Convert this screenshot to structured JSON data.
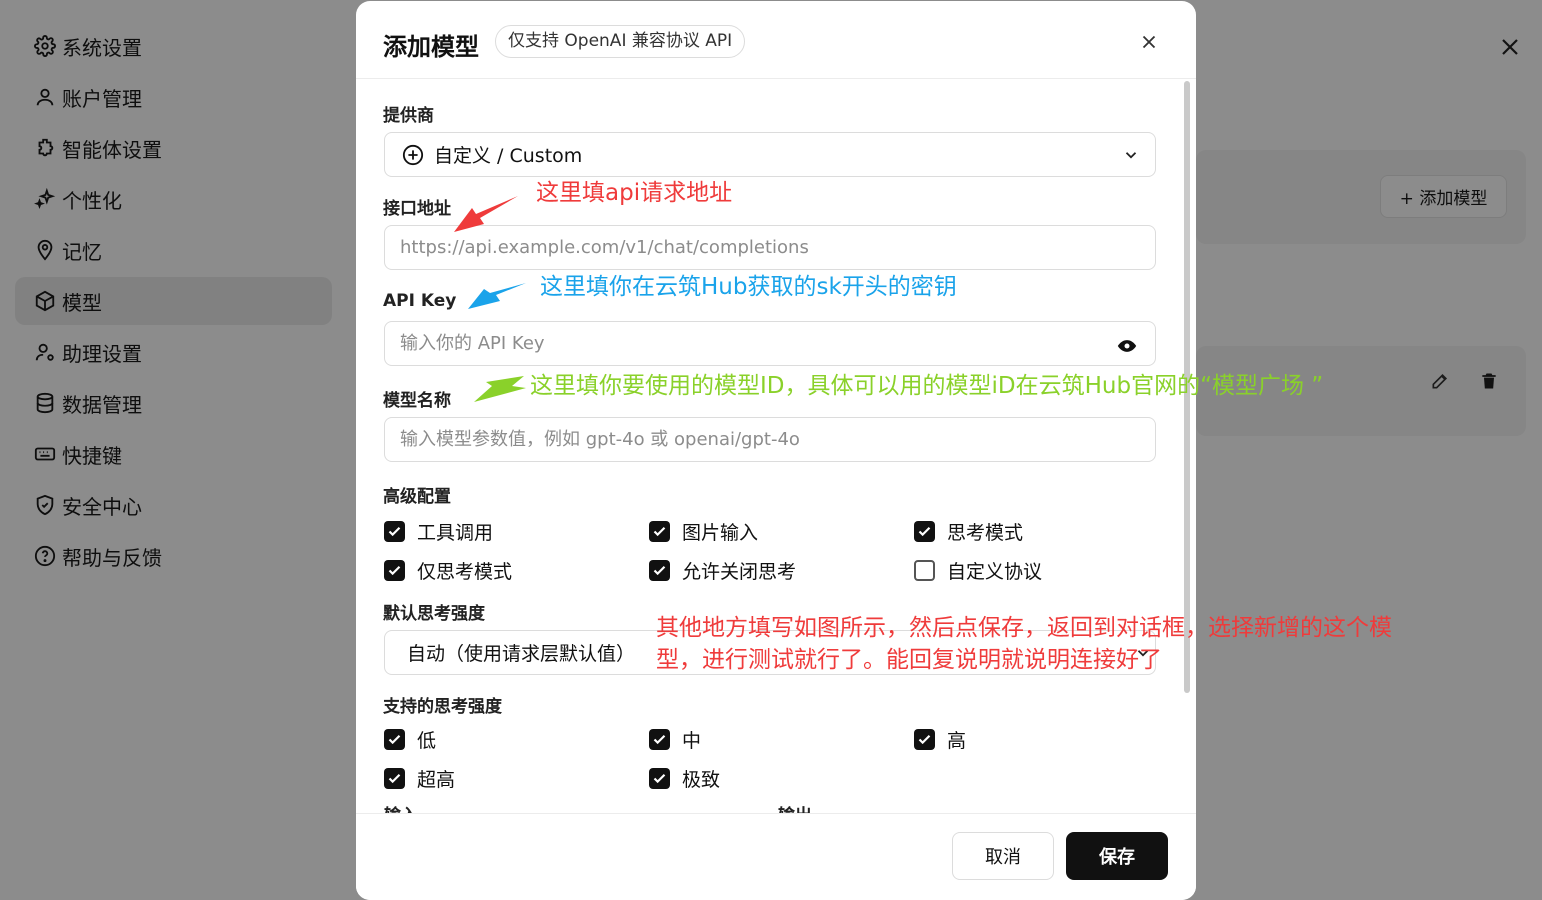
{
  "sidebar": {
    "items": [
      {
        "label": "系统设置",
        "icon": "gear-icon",
        "active": false
      },
      {
        "label": "账户管理",
        "icon": "user-icon",
        "active": false
      },
      {
        "label": "智能体设置",
        "icon": "puzzle-icon",
        "active": false
      },
      {
        "label": "个性化",
        "icon": "sparkle-icon",
        "active": false
      },
      {
        "label": "记忆",
        "icon": "brain-pin-icon",
        "active": false
      },
      {
        "label": "模型",
        "icon": "cube-icon",
        "active": true
      },
      {
        "label": "助理设置",
        "icon": "user-gear-icon",
        "active": false
      },
      {
        "label": "数据管理",
        "icon": "database-icon",
        "active": false
      },
      {
        "label": "快捷键",
        "icon": "keyboard-icon",
        "active": false
      },
      {
        "label": "安全中心",
        "icon": "shield-icon",
        "active": false
      },
      {
        "label": "帮助与反馈",
        "icon": "help-circle-icon",
        "active": false
      }
    ]
  },
  "background": {
    "add_model_label": "+ 添加模型"
  },
  "modal": {
    "title": "添加模型",
    "badge": "仅支持 OpenAI 兼容协议 API",
    "provider": {
      "label": "提供商",
      "value": "自定义 / Custom"
    },
    "endpoint": {
      "label": "接口地址",
      "value": "",
      "placeholder": "https://api.example.com/v1/chat/completions"
    },
    "api_key": {
      "label": "API Key",
      "value": "",
      "placeholder": "输入你的 API Key"
    },
    "model_name": {
      "label": "模型名称",
      "value": "",
      "placeholder": "输入模型参数值，例如 gpt-4o 或 openai/gpt-4o"
    },
    "advanced": {
      "label": "高级配置",
      "options": [
        {
          "label": "工具调用",
          "checked": true
        },
        {
          "label": "图片输入",
          "checked": true
        },
        {
          "label": "思考模式",
          "checked": true
        },
        {
          "label": "仅思考模式",
          "checked": true
        },
        {
          "label": "允许关闭思考",
          "checked": true
        },
        {
          "label": "自定义协议",
          "checked": false
        }
      ]
    },
    "default_reasoning": {
      "label": "默认思考强度",
      "value": "自动（使用请求层默认值）"
    },
    "supported_reasoning": {
      "label": "支持的思考强度",
      "options": [
        {
          "label": "低",
          "checked": true
        },
        {
          "label": "中",
          "checked": true
        },
        {
          "label": "高",
          "checked": true
        },
        {
          "label": "超高",
          "checked": true
        },
        {
          "label": "极致",
          "checked": true
        }
      ]
    },
    "cut_labels": [
      "输入",
      "输出"
    ],
    "cancel_label": "取消",
    "save_label": "保存"
  },
  "annotations": {
    "endpoint_note": "这里填api请求地址",
    "api_key_note": "这里填你在云筑Hub获取的sk开头的密钥",
    "model_note": "这里填你要使用的模型ID，具体可以用的模型iD在云筑Hub官网的“模型广场 ”",
    "summary_note": "其他地方填写如图所示，然后点保存，返回到对话框，选择新增的这个模型，进行测试就行了。能回复说明就说明连接好了",
    "colors": {
      "red": "#ef3b3b",
      "blue": "#1aa3ea",
      "green": "#8ad12a"
    }
  }
}
